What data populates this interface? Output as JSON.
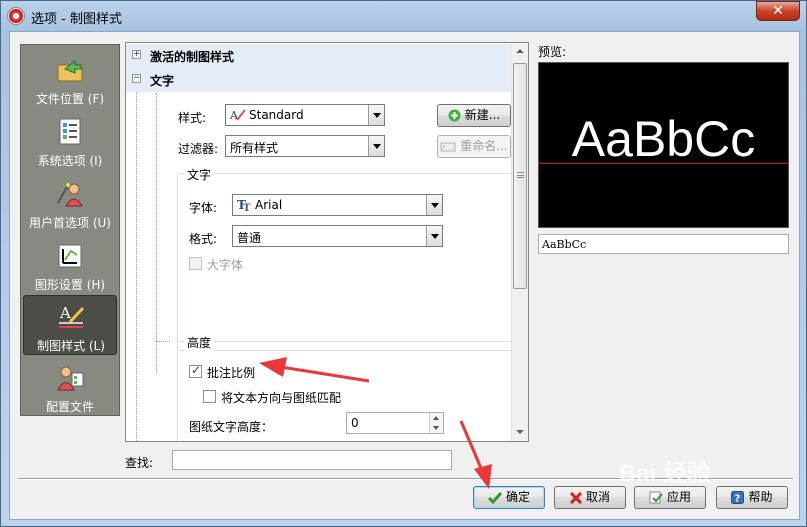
{
  "window": {
    "title": "选项 - 制图样式",
    "close_glyph": "✕"
  },
  "nav": {
    "items": [
      {
        "label": "文件位置 (F)",
        "icon": "folder-arrow-icon",
        "selected": false
      },
      {
        "label": "系统选项 (I)",
        "icon": "checklist-icon",
        "selected": false
      },
      {
        "label": "用户首选项 (U)",
        "icon": "user-wand-icon",
        "selected": false
      },
      {
        "label": "图形设置 (H)",
        "icon": "graphics-settings-icon",
        "selected": false
      },
      {
        "label": "制图样式 (L)",
        "icon": "drafting-style-icon",
        "selected": true
      },
      {
        "label": "配置文件",
        "icon": "profile-icon",
        "selected": false
      }
    ]
  },
  "panel": {
    "category_active": "激活的制图样式",
    "category_text": "文字",
    "style_label": "样式:",
    "style_value": "Standard",
    "new_button": "新建...",
    "filter_label": "过滤器:",
    "filter_value": "所有样式",
    "rename_button": "重命名...",
    "text_group_title": "文字",
    "font_label": "字体:",
    "font_value": "Arial",
    "format_label": "格式:",
    "format_value": "普通",
    "bigfont_label": "大字体",
    "height_group_title": "高度",
    "annotative_label": "批注比例",
    "annotative_checked": true,
    "match_orientation_label": "将文本方向与图纸匹配",
    "match_orientation_checked": false,
    "paper_height_label": "图纸文字高度：",
    "paper_height_value": "0"
  },
  "preview": {
    "label": "预览:",
    "sample_text": "AaBbCc",
    "field_value": "AaBbCc"
  },
  "find": {
    "label": "查找:",
    "value": ""
  },
  "buttons": {
    "ok": "确定",
    "cancel": "取消",
    "apply": "应用",
    "help": "帮助"
  },
  "watermark": "Bai 经验",
  "colors": {
    "accent_red": "#e8383a",
    "selected_nav": "#4b4d46",
    "category_bg": "#e4ecf7"
  }
}
